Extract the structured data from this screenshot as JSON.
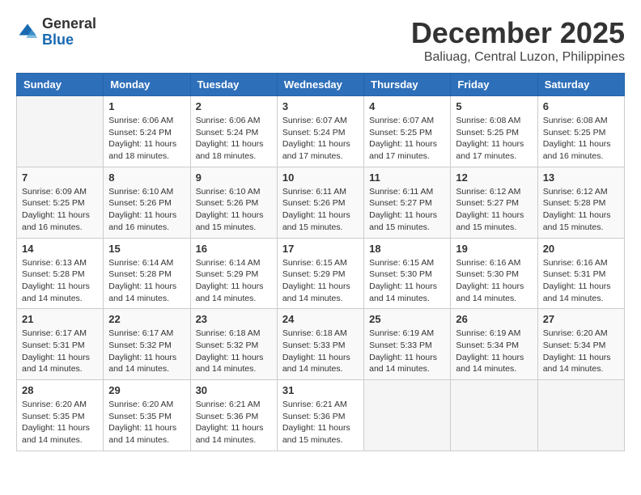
{
  "header": {
    "logo_general": "General",
    "logo_blue": "Blue",
    "month_title": "December 2025",
    "location": "Baliuag, Central Luzon, Philippines"
  },
  "calendar": {
    "days_of_week": [
      "Sunday",
      "Monday",
      "Tuesday",
      "Wednesday",
      "Thursday",
      "Friday",
      "Saturday"
    ],
    "weeks": [
      [
        {
          "day": "",
          "info": ""
        },
        {
          "day": "1",
          "info": "Sunrise: 6:06 AM\nSunset: 5:24 PM\nDaylight: 11 hours and 18 minutes."
        },
        {
          "day": "2",
          "info": "Sunrise: 6:06 AM\nSunset: 5:24 PM\nDaylight: 11 hours and 18 minutes."
        },
        {
          "day": "3",
          "info": "Sunrise: 6:07 AM\nSunset: 5:24 PM\nDaylight: 11 hours and 17 minutes."
        },
        {
          "day": "4",
          "info": "Sunrise: 6:07 AM\nSunset: 5:25 PM\nDaylight: 11 hours and 17 minutes."
        },
        {
          "day": "5",
          "info": "Sunrise: 6:08 AM\nSunset: 5:25 PM\nDaylight: 11 hours and 17 minutes."
        },
        {
          "day": "6",
          "info": "Sunrise: 6:08 AM\nSunset: 5:25 PM\nDaylight: 11 hours and 16 minutes."
        }
      ],
      [
        {
          "day": "7",
          "info": "Sunrise: 6:09 AM\nSunset: 5:25 PM\nDaylight: 11 hours and 16 minutes."
        },
        {
          "day": "8",
          "info": "Sunrise: 6:10 AM\nSunset: 5:26 PM\nDaylight: 11 hours and 16 minutes."
        },
        {
          "day": "9",
          "info": "Sunrise: 6:10 AM\nSunset: 5:26 PM\nDaylight: 11 hours and 15 minutes."
        },
        {
          "day": "10",
          "info": "Sunrise: 6:11 AM\nSunset: 5:26 PM\nDaylight: 11 hours and 15 minutes."
        },
        {
          "day": "11",
          "info": "Sunrise: 6:11 AM\nSunset: 5:27 PM\nDaylight: 11 hours and 15 minutes."
        },
        {
          "day": "12",
          "info": "Sunrise: 6:12 AM\nSunset: 5:27 PM\nDaylight: 11 hours and 15 minutes."
        },
        {
          "day": "13",
          "info": "Sunrise: 6:12 AM\nSunset: 5:28 PM\nDaylight: 11 hours and 15 minutes."
        }
      ],
      [
        {
          "day": "14",
          "info": "Sunrise: 6:13 AM\nSunset: 5:28 PM\nDaylight: 11 hours and 14 minutes."
        },
        {
          "day": "15",
          "info": "Sunrise: 6:14 AM\nSunset: 5:28 PM\nDaylight: 11 hours and 14 minutes."
        },
        {
          "day": "16",
          "info": "Sunrise: 6:14 AM\nSunset: 5:29 PM\nDaylight: 11 hours and 14 minutes."
        },
        {
          "day": "17",
          "info": "Sunrise: 6:15 AM\nSunset: 5:29 PM\nDaylight: 11 hours and 14 minutes."
        },
        {
          "day": "18",
          "info": "Sunrise: 6:15 AM\nSunset: 5:30 PM\nDaylight: 11 hours and 14 minutes."
        },
        {
          "day": "19",
          "info": "Sunrise: 6:16 AM\nSunset: 5:30 PM\nDaylight: 11 hours and 14 minutes."
        },
        {
          "day": "20",
          "info": "Sunrise: 6:16 AM\nSunset: 5:31 PM\nDaylight: 11 hours and 14 minutes."
        }
      ],
      [
        {
          "day": "21",
          "info": "Sunrise: 6:17 AM\nSunset: 5:31 PM\nDaylight: 11 hours and 14 minutes."
        },
        {
          "day": "22",
          "info": "Sunrise: 6:17 AM\nSunset: 5:32 PM\nDaylight: 11 hours and 14 minutes."
        },
        {
          "day": "23",
          "info": "Sunrise: 6:18 AM\nSunset: 5:32 PM\nDaylight: 11 hours and 14 minutes."
        },
        {
          "day": "24",
          "info": "Sunrise: 6:18 AM\nSunset: 5:33 PM\nDaylight: 11 hours and 14 minutes."
        },
        {
          "day": "25",
          "info": "Sunrise: 6:19 AM\nSunset: 5:33 PM\nDaylight: 11 hours and 14 minutes."
        },
        {
          "day": "26",
          "info": "Sunrise: 6:19 AM\nSunset: 5:34 PM\nDaylight: 11 hours and 14 minutes."
        },
        {
          "day": "27",
          "info": "Sunrise: 6:20 AM\nSunset: 5:34 PM\nDaylight: 11 hours and 14 minutes."
        }
      ],
      [
        {
          "day": "28",
          "info": "Sunrise: 6:20 AM\nSunset: 5:35 PM\nDaylight: 11 hours and 14 minutes."
        },
        {
          "day": "29",
          "info": "Sunrise: 6:20 AM\nSunset: 5:35 PM\nDaylight: 11 hours and 14 minutes."
        },
        {
          "day": "30",
          "info": "Sunrise: 6:21 AM\nSunset: 5:36 PM\nDaylight: 11 hours and 14 minutes."
        },
        {
          "day": "31",
          "info": "Sunrise: 6:21 AM\nSunset: 5:36 PM\nDaylight: 11 hours and 15 minutes."
        },
        {
          "day": "",
          "info": ""
        },
        {
          "day": "",
          "info": ""
        },
        {
          "day": "",
          "info": ""
        }
      ]
    ]
  }
}
